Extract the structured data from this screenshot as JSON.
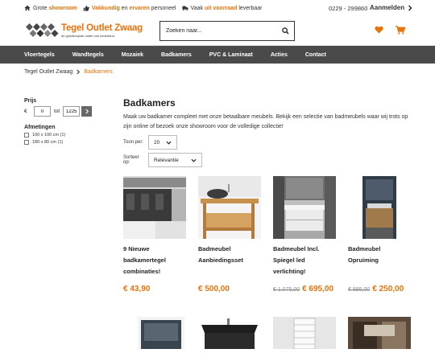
{
  "topbar": {
    "usps": [
      {
        "icon": "home-icon",
        "pre": "Grote ",
        "bold": "showroom",
        "post": ""
      },
      {
        "icon": "thumbs-up-icon",
        "pre": "",
        "bold": "Vakkundig",
        "mid": " en ",
        "bold2": "ervaren",
        "post": " personeel"
      },
      {
        "icon": "truck-icon",
        "pre": "Vaak ",
        "bold": "uit voorraad",
        "post": " leverbaar"
      }
    ],
    "phone": "0229 - 299860",
    "login": "Aanmelden"
  },
  "logo": {
    "title": "Tegel Outlet Zwaag",
    "subtitle": "de goedkoopste outlet van nederland"
  },
  "search": {
    "placeholder": "Zoeken naar..."
  },
  "nav": [
    "Vloertegels",
    "Wandtegels",
    "Mozaiek",
    "Badkamers",
    "PVC & Laminaat",
    "Acties",
    "Contact"
  ],
  "breadcrumb": {
    "home": "Tegel Outlet Zwaag",
    "current": "Badkamers"
  },
  "filters": {
    "price_title": "Prijs",
    "price_min": "0",
    "price_to": "tot",
    "price_max": "1225",
    "dim_title": "Afmetingen",
    "dims": [
      "100 x 100 cm (1)",
      "180 x 80 cm (1)"
    ]
  },
  "page": {
    "title": "Badkamers",
    "description": "Maak uw badkamer compleet met onze betaalbare meubels. Bekijk een selectie van badmeubels waar wij trots op zijn online of bezoek onze showroom voor de volledige collectie!",
    "per_page_label": "Toon per:",
    "per_page_value": "20",
    "sort_label": "Sorteer op:",
    "sort_value": "Relevantie"
  },
  "products": [
    {
      "name": "9 Nieuwe badkamertegel combinaties!",
      "old_price": "",
      "price": "€ 43,90"
    },
    {
      "name": "Badmeubel Aanbiedingsset",
      "old_price": "",
      "price": "€ 500,00"
    },
    {
      "name": "Badmeubel Incl. Spiegel led verlichting!",
      "old_price": "€ 1.075,00",
      "price": "€ 695,00"
    },
    {
      "name": "Badmeubel Opruiming",
      "old_price": "€ 895,00",
      "price": "€ 250,00"
    }
  ],
  "colors": {
    "accent": "#e8730c",
    "nav_bg": "#4a4a4a"
  }
}
